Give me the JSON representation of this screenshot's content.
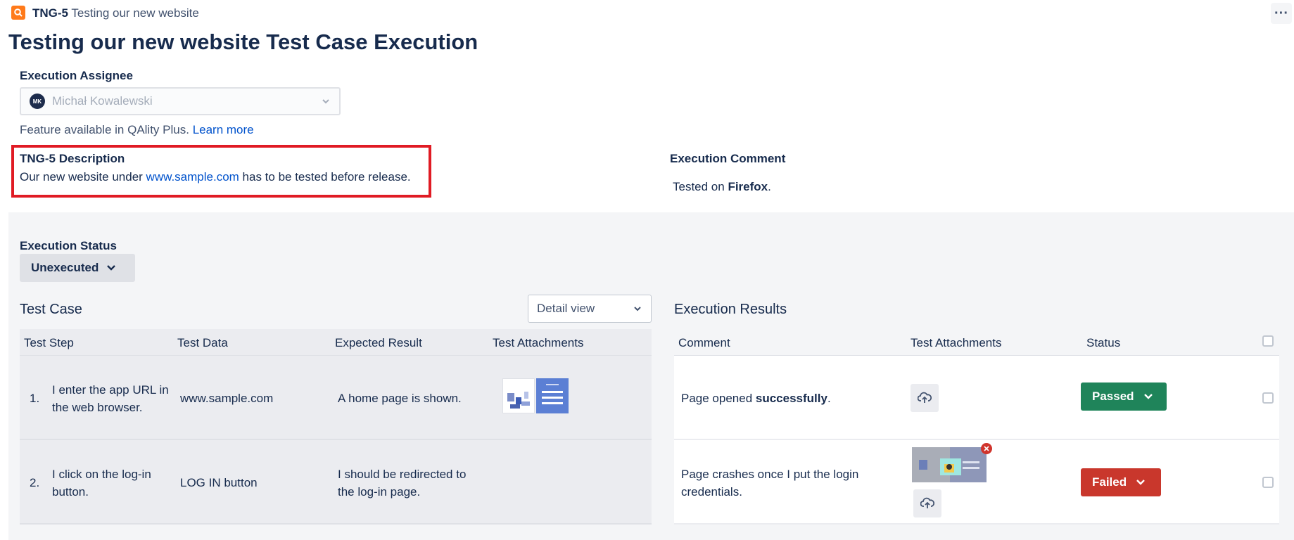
{
  "header": {
    "issue_key": "TNG-5",
    "issue_title": "Testing our new website",
    "page_title": "Testing our new website Test Case Execution",
    "more_label": "···"
  },
  "assignee": {
    "label": "Execution Assignee",
    "initials": "MK",
    "value": "Michał Kowalewski",
    "feature_note": "Feature available in QAlity Plus.",
    "learn_more": "Learn more"
  },
  "description": {
    "label": "TNG-5 Description",
    "text_before": "Our new website under ",
    "link": "www.sample.com",
    "text_after": " has to be tested before release."
  },
  "execution_comment": {
    "label": "Execution Comment",
    "text_before": "Tested on ",
    "bold": "Firefox",
    "text_after": "."
  },
  "execution_status": {
    "label": "Execution Status",
    "value": "Unexecuted"
  },
  "test_case": {
    "title": "Test Case",
    "view_select": "Detail view",
    "columns": [
      "Test Step",
      "Test Data",
      "Expected Result",
      "Test Attachments"
    ],
    "rows": [
      {
        "num": "1.",
        "step_line1": "I enter the app URL in",
        "step_line2": "the web browser.",
        "data": "www.sample.com",
        "expected_line1": "A home page is shown.",
        "expected_line2": ""
      },
      {
        "num": "2.",
        "step_line1": "I click on the log-in",
        "step_line2": "button.",
        "data": "LOG IN button",
        "expected_line1": "I should be redirected to",
        "expected_line2": "the log-in page."
      }
    ]
  },
  "execution_results": {
    "title": "Execution Results",
    "columns": [
      "Comment",
      "Test Attachments",
      "Status"
    ],
    "rows": [
      {
        "comment_before": "Page opened ",
        "comment_bold": "successfully",
        "comment_after": ".",
        "status": "Passed",
        "status_color": "#1f845a"
      },
      {
        "comment_line1": "Page crashes once I put the login",
        "comment_line2": "credentials.",
        "status": "Failed",
        "status_color": "#c9372c"
      }
    ]
  },
  "colors": {
    "accent": "#0052cc",
    "highlight_border": "#e01b24",
    "text": "#172b4d",
    "panel": "#f4f5f7"
  },
  "icons": {
    "issue": "search-icon",
    "upload": "cloud-upload-icon",
    "dropdown": "chevron-down-icon",
    "remove": "close-icon"
  }
}
